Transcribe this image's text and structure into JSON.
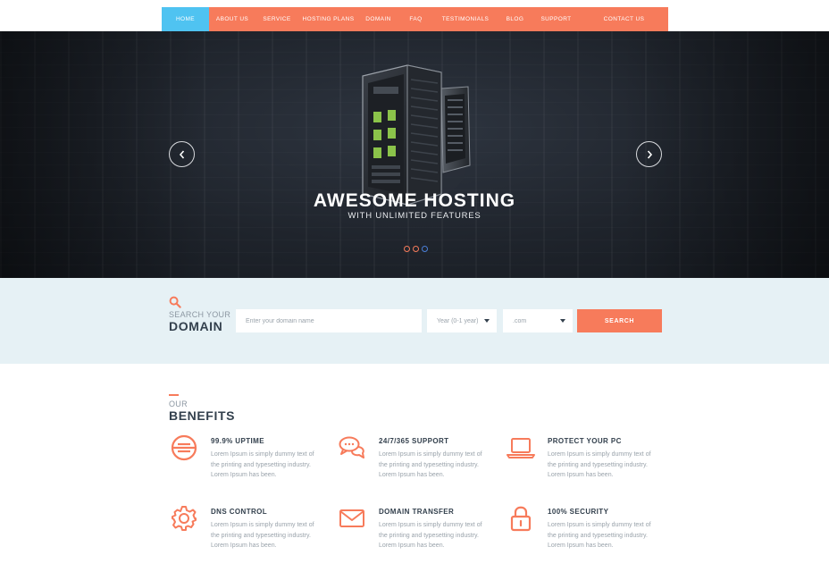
{
  "nav": {
    "items": [
      {
        "label": "HOME",
        "active": true
      },
      {
        "label": "ABOUT US",
        "active": false
      },
      {
        "label": "SERVICE",
        "active": false
      },
      {
        "label": "HOSTING PLANS",
        "active": false
      },
      {
        "label": "DOMAIN",
        "active": false
      },
      {
        "label": "FAQ",
        "active": false
      },
      {
        "label": "TESTIMONIALS",
        "active": false
      },
      {
        "label": "BLOG",
        "active": false
      },
      {
        "label": "SUPPORT",
        "active": false
      },
      {
        "label": "CONTACT US",
        "active": false
      }
    ]
  },
  "hero": {
    "title": "AWESOME HOSTING",
    "subtitle": "WITH UNLIMITED FEATURES",
    "prev_icon": "chevron-left-icon",
    "next_icon": "chevron-right-icon",
    "slides": 3,
    "active_slide": 3
  },
  "domain_search": {
    "icon": "search-icon",
    "label_small": "SEARCH YOUR",
    "label_big": "DOMAIN",
    "input_placeholder": "Enter your domain name",
    "year_select": "Year (0-1 year)",
    "tld_select": ".com",
    "button_label": "SEARCH"
  },
  "benefits": {
    "label_small": "OUR",
    "label_big": "BENEFITS",
    "items": [
      {
        "icon": "uptime-icon",
        "title": "99.9% UPTIME",
        "text": "Lorem Ipsum is simply dummy text of the printing and typesetting industry. Lorem Ipsum has been."
      },
      {
        "icon": "chat-bubbles-icon",
        "title": "24/7/365 SUPPORT",
        "text": "Lorem Ipsum is simply dummy text of the printing and typesetting industry. Lorem Ipsum has been."
      },
      {
        "icon": "laptop-icon",
        "title": "PROTECT YOUR PC",
        "text": "Lorem Ipsum is simply dummy text of the printing and typesetting industry. Lorem Ipsum has been."
      },
      {
        "icon": "gear-icon",
        "title": "DNS CONTROL",
        "text": "Lorem Ipsum is simply dummy text of the printing and typesetting industry. Lorem Ipsum has been."
      },
      {
        "icon": "envelope-icon",
        "title": "DOMAIN TRANSFER",
        "text": "Lorem Ipsum is simply dummy text of the printing and typesetting industry. Lorem Ipsum has been."
      },
      {
        "icon": "lock-icon",
        "title": "100% SECURITY",
        "text": "Lorem Ipsum is simply dummy text of the printing and typesetting industry. Lorem Ipsum has been."
      }
    ]
  },
  "colors": {
    "accent": "#f77b5b",
    "active_nav": "#4fc3f1",
    "heading": "#33404d",
    "muted": "#9aa3ab",
    "band": "#e6f1f5"
  }
}
